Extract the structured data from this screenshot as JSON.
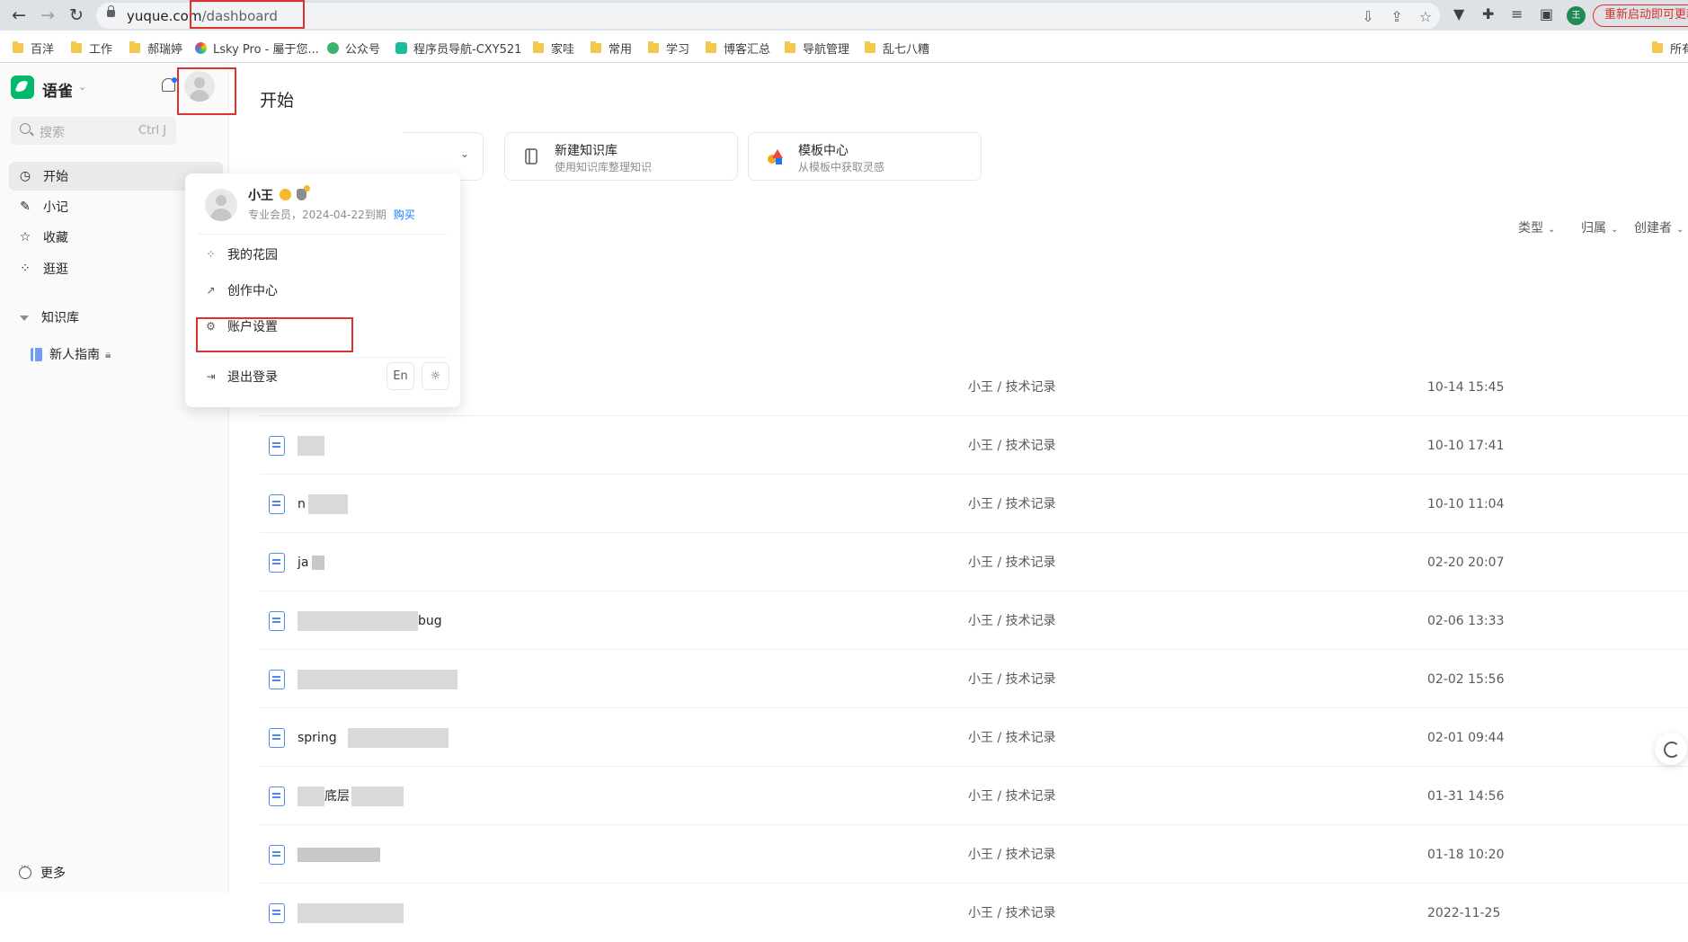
{
  "browser": {
    "url_domain": "yuque.com",
    "url_path": "/dashboard",
    "restart_label": "重新启动即可更新",
    "profile_initial": "王"
  },
  "bookmarks": [
    {
      "label": "百洋",
      "type": "folder"
    },
    {
      "label": "工作",
      "type": "folder"
    },
    {
      "label": "郝瑞婷",
      "type": "folder"
    },
    {
      "label": "Lsky Pro - 屬于您...",
      "type": "site"
    },
    {
      "label": "公众号",
      "type": "site"
    },
    {
      "label": "程序员导航-CXY521",
      "type": "site"
    },
    {
      "label": "家哇",
      "type": "folder"
    },
    {
      "label": "常用",
      "type": "folder"
    },
    {
      "label": "学习",
      "type": "folder"
    },
    {
      "label": "博客汇总",
      "type": "folder"
    },
    {
      "label": "导航管理",
      "type": "folder"
    },
    {
      "label": "乱七八糟",
      "type": "folder"
    },
    {
      "label": "所有",
      "type": "folder"
    }
  ],
  "sidebar": {
    "app_name": "语雀",
    "search_placeholder": "搜索",
    "search_shortcut": "Ctrl J",
    "nav": [
      {
        "label": "开始",
        "icon": "clock-icon",
        "active": true
      },
      {
        "label": "小记",
        "icon": "feather-icon",
        "active": false
      },
      {
        "label": "收藏",
        "icon": "star-icon",
        "active": false
      },
      {
        "label": "逛逛",
        "icon": "grid-icon",
        "active": false
      }
    ],
    "kb_section": "知识库",
    "kb_items": [
      {
        "label": "新人指南"
      }
    ],
    "more_label": "更多"
  },
  "main": {
    "title": "开始",
    "cards": [
      {
        "title": "新建知识库",
        "subtitle": "使用知识库整理知识"
      },
      {
        "title": "模板中心",
        "subtitle": "从模板中获取灵感"
      }
    ],
    "filters": [
      "类型",
      "归属",
      "创建者"
    ],
    "rows": [
      {
        "title": "",
        "kb": "小王 / 技术记录",
        "time": "10-14 15:45"
      },
      {
        "title": "",
        "kb": "小王 / 技术记录",
        "time": "10-10 17:41"
      },
      {
        "title": "n",
        "kb": "小王 / 技术记录",
        "time": "10-10 11:04"
      },
      {
        "title": "ja",
        "kb": "小王 / 技术记录",
        "time": "02-20 20:07"
      },
      {
        "title": "bug",
        "kb": "小王 / 技术记录",
        "time": "02-06 13:33"
      },
      {
        "title": "",
        "kb": "小王 / 技术记录",
        "time": "02-02 15:56"
      },
      {
        "title": "spring",
        "kb": "小王 / 技术记录",
        "time": "02-01 09:44"
      },
      {
        "title": "底层",
        "kb": "小王 / 技术记录",
        "time": "01-31 14:56"
      },
      {
        "title": "",
        "kb": "小王 / 技术记录",
        "time": "01-18 10:20"
      },
      {
        "title": "",
        "kb": "小王 / 技术记录",
        "time": "2022-11-25"
      }
    ]
  },
  "user_menu": {
    "name": "小王",
    "membership": "专业会员，2024-04-22到期",
    "buy_label": "购买",
    "items": [
      {
        "label": "我的花园",
        "icon": "garden-icon"
      },
      {
        "label": "创作中心",
        "icon": "chart-icon"
      },
      {
        "label": "账户设置",
        "icon": "gear-icon"
      }
    ],
    "logout_label": "退出登录",
    "lang_label": "En"
  }
}
